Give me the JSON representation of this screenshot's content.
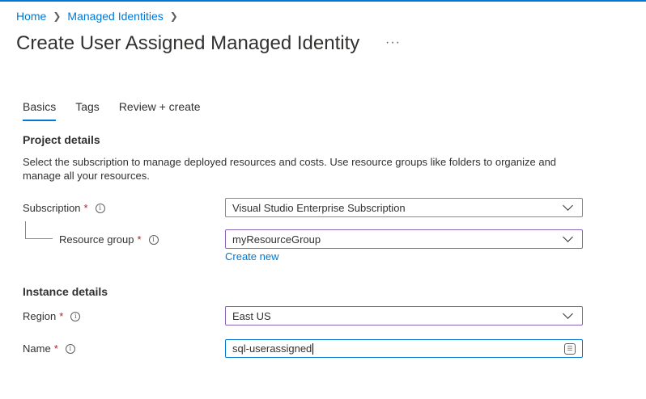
{
  "breadcrumb": {
    "items": [
      "Home",
      "Managed Identities"
    ]
  },
  "page": {
    "title": "Create User Assigned Managed Identity",
    "more_label": "···"
  },
  "tabs": [
    {
      "label": "Basics",
      "active": true
    },
    {
      "label": "Tags",
      "active": false
    },
    {
      "label": "Review + create",
      "active": false
    }
  ],
  "project": {
    "heading": "Project details",
    "description": "Select the subscription to manage deployed resources and costs. Use resource groups like folders to organize and manage all your resources.",
    "subscription": {
      "label": "Subscription",
      "value": "Visual Studio Enterprise Subscription"
    },
    "resource_group": {
      "label": "Resource group",
      "value": "myResourceGroup",
      "create_new": "Create new"
    }
  },
  "instance": {
    "heading": "Instance details",
    "region": {
      "label": "Region",
      "value": "East US"
    },
    "name": {
      "label": "Name",
      "value": "sql-userassigned"
    }
  },
  "common": {
    "required_mark": "*",
    "info_glyph": "i"
  },
  "colors": {
    "accent": "#0078d4",
    "focus_purple": "#8764b8",
    "required": "#a4262c"
  }
}
